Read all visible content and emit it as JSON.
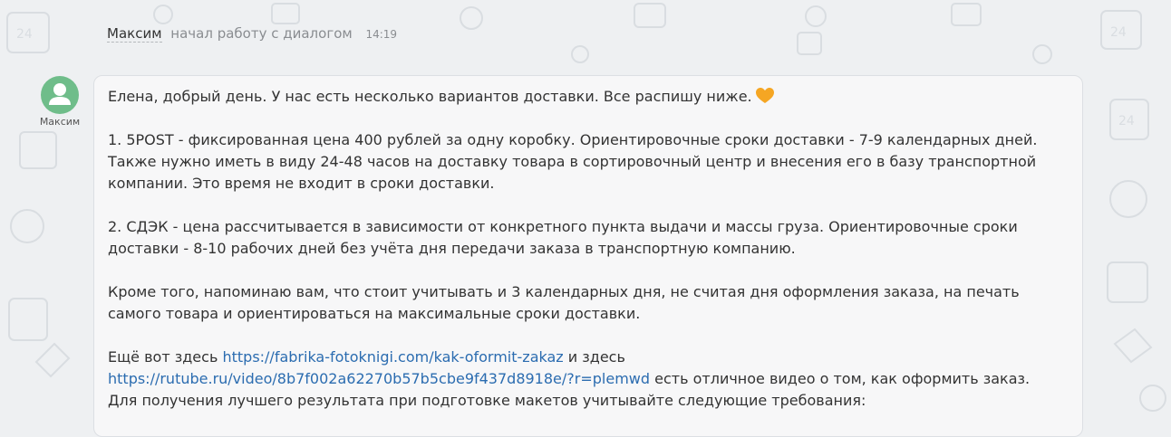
{
  "system_message": {
    "author": "Максим",
    "action": "начал работу с диалогом",
    "time": "14:19"
  },
  "avatar": {
    "name": "Максим",
    "color": "#6fbd8a",
    "icon": "user-icon"
  },
  "message": {
    "greeting": "Елена, добрый день. У нас есть несколько вариантов доставки. Все распишу ниже.",
    "emoji": "orange-heart",
    "option1": "1. 5POST - фиксированная цена 400 рублей за одну коробку. Ориентировочные сроки доставки - 7-9 календарных дней. Также нужно иметь в виду 24-48 часов на доставку товара в сортировочный центр и внесения его в базу транспортной компании. Это время не входит в сроки доставки.",
    "option2": "2. СДЭК - цена рассчитывается в зависимости от конкретного пункта выдачи и массы груза. Ориентировочные сроки доставки - 8-10 рабочих дней без учёта дня передачи заказа в транспортную компанию.",
    "note": "Кроме того, напоминаю вам, что стоит учитывать и 3 календарных дня, не считая дня оформления заказа, на печать самого товара и ориентироваться на максимальные сроки доставки.",
    "links_prefix": "Ещё вот здесь",
    "link1": "https://fabrika-fotoknigi.com/kak-oformit-zakaz",
    "links_middle": "и здесь",
    "link2": "https://rutube.ru/video/8b7f002a62270b57b5cbe9f437d8918e/?r=plemwd",
    "links_suffix": "есть отличное видео о том, как оформить заказ.",
    "requirements": "Для получения лучшего результата при подготовке макетов учитывайте следующие требования:"
  },
  "colors": {
    "background": "#eef0f2",
    "bubble": "#f7f7f8",
    "link": "#2b6cb0",
    "heart": "#f5a623"
  }
}
